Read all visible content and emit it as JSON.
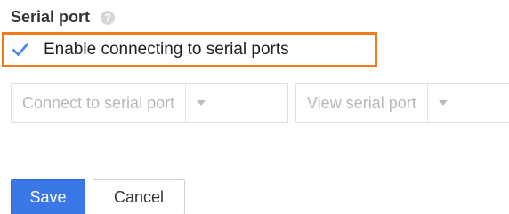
{
  "section": {
    "title": "Serial port",
    "help_icon": "help-circle-icon",
    "help_glyph": "?"
  },
  "checkbox": {
    "label": "Enable connecting to serial ports",
    "checked": true,
    "check_color": "#4285f4",
    "highlight_color": "#f07c1c"
  },
  "connect_button": {
    "label": "Connect to serial port",
    "disabled": true,
    "arrow_icon": "dropdown-arrow-icon"
  },
  "view_button": {
    "label": "View serial port",
    "disabled": true,
    "arrow_icon": "dropdown-arrow-icon"
  },
  "actions": {
    "save_label": "Save",
    "cancel_label": "Cancel",
    "primary_color": "#3b78e7"
  }
}
